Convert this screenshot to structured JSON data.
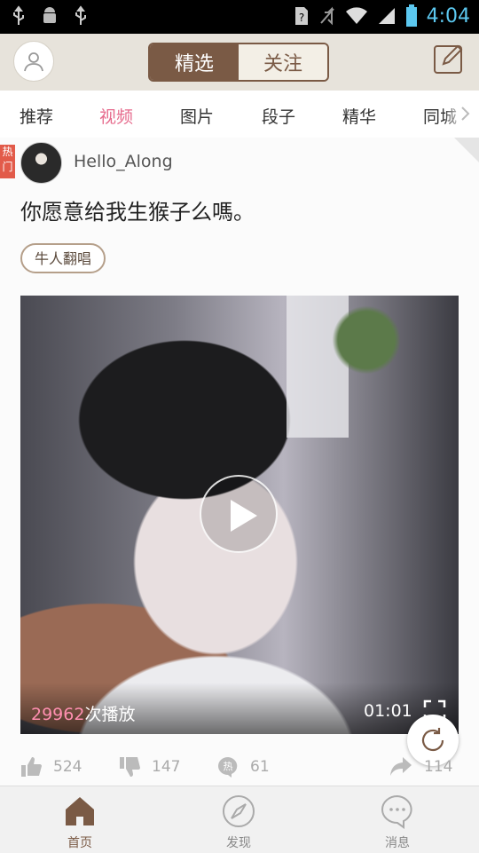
{
  "status_bar": {
    "time": "4:04"
  },
  "header": {
    "segments": [
      "精选",
      "关注"
    ],
    "active_segment": 0,
    "accent_color": "#7a5a45"
  },
  "tabs": {
    "items": [
      "推荐",
      "视频",
      "图片",
      "段子",
      "精华",
      "同城"
    ],
    "active": "视频",
    "active_color": "#e66a8c"
  },
  "post": {
    "hot_badge": "热门",
    "username": "Hello_Along",
    "title": "你愿意给我生猴子么嗎。",
    "tag": "牛人翻唱",
    "video": {
      "play_count": "29962",
      "play_count_suffix": "次播放",
      "duration": "01:01"
    },
    "actions": {
      "likes": "524",
      "dislikes": "147",
      "comments": "61",
      "shares": "114"
    }
  },
  "bottom_nav": {
    "items": [
      "首页",
      "发现",
      "消息"
    ],
    "active": "首页"
  }
}
